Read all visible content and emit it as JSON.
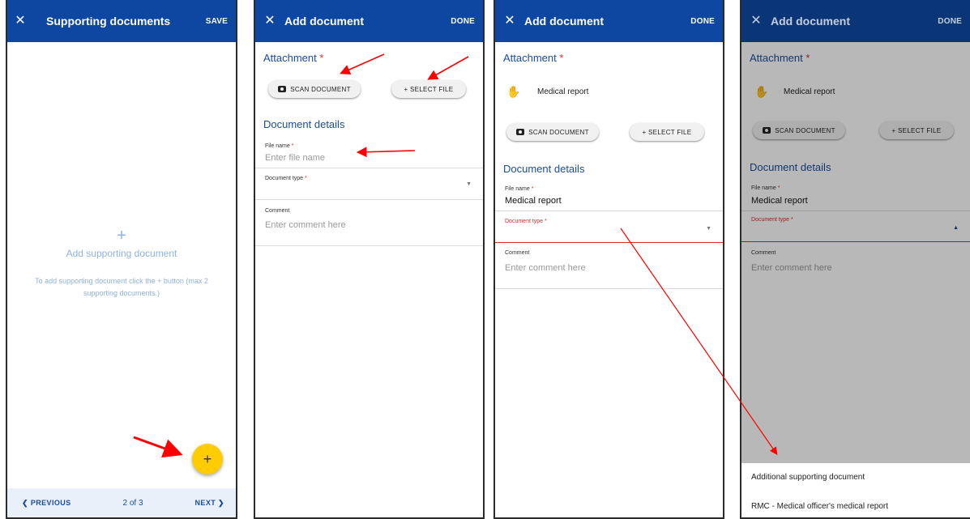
{
  "colors": {
    "appbar": "#0d47a1",
    "accent_yellow": "#ffcc00",
    "required": "#d32f2f",
    "annotation_arrow": "#ff0000"
  },
  "screen1": {
    "close_icon": "close-icon",
    "title": "Supporting documents",
    "action": "SAVE",
    "empty_plus": "+",
    "empty_title": "Add supporting document",
    "empty_hint": "To add supporting document click the + button (max 2 supporting documents.)",
    "fab_label": "+",
    "pager": {
      "prev": "❮ PREVIOUS",
      "count": "2 of 3",
      "next": "NEXT ❯"
    }
  },
  "screen2": {
    "title": "Add document",
    "action": "DONE",
    "attachment_label": "Attachment",
    "required_mark": "*",
    "scan_button": "SCAN DOCUMENT",
    "select_button": "+ SELECT FILE",
    "details_title": "Document details",
    "file_name_label": "File name",
    "file_name_placeholder": "Enter file name",
    "doc_type_label": "Document type",
    "comment_label": "Comment",
    "comment_placeholder": "Enter comment here"
  },
  "screen3": {
    "title": "Add document",
    "action": "DONE",
    "attachment_label": "Attachment",
    "required_mark": "*",
    "attachment_name": "Medical report",
    "scan_button": "SCAN DOCUMENT",
    "select_button": "+ SELECT FILE",
    "details_title": "Document details",
    "file_name_label": "File name",
    "file_name_value": "Medical report",
    "doc_type_label": "Document type",
    "comment_label": "Comment",
    "comment_placeholder": "Enter comment here"
  },
  "screen4": {
    "title": "Add document",
    "action": "DONE",
    "attachment_label": "Attachment",
    "required_mark": "*",
    "attachment_name": "Medical report",
    "scan_button": "SCAN DOCUMENT",
    "select_button": "+ SELECT FILE",
    "details_title": "Document details",
    "file_name_label": "File name",
    "file_name_value": "Medical report",
    "doc_type_label": "Document type",
    "comment_label": "Comment",
    "comment_placeholder": "Enter comment here",
    "options": [
      "Additional supporting document",
      "RMC - Medical officer's medical report"
    ]
  }
}
